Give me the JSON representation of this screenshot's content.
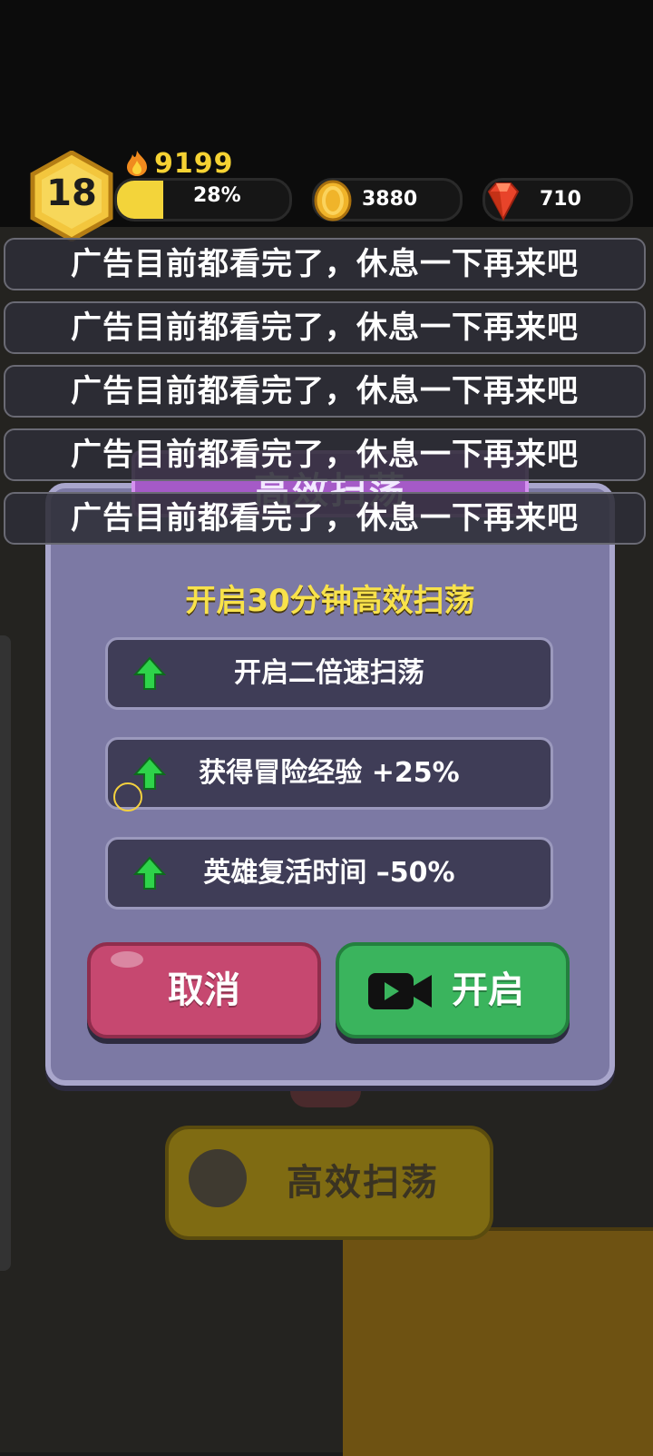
{
  "hud": {
    "level": "18",
    "power": "9199",
    "xp_percent": "28%",
    "xp_fraction": 0.28,
    "gold": "3880",
    "gems": "710",
    "colors": {
      "power": "#f5d233",
      "level_badge": "#f3c63d",
      "gem": "#e8442a",
      "coin": "#f0b42a"
    }
  },
  "notices": [
    "广告目前都看完了，休息一下再来吧",
    "广告目前都看完了，休息一下再来吧",
    "广告目前都看完了，休息一下再来吧",
    "广告目前都看完了，休息一下再来吧",
    "广告目前都看完了，休息一下再来吧"
  ],
  "dialog": {
    "title": "高效扫荡",
    "heading": "开启30分钟高效扫荡",
    "benefits": [
      {
        "text": "开启二倍速扫荡",
        "icon": "green-up-arrow-icon"
      },
      {
        "text": "获得冒险经验  +25%",
        "icon": "green-up-arrow-icon"
      },
      {
        "text": "英雄复活时间  –50%",
        "icon": "green-up-arrow-icon"
      }
    ],
    "cancel_label": "取消",
    "open_label": "开启",
    "open_icon": "video-camera-icon",
    "colors": {
      "panel": "#7c79a4",
      "cancel": "#c64870",
      "open": "#3ab45d",
      "heading": "#f8e24a"
    }
  },
  "background": {
    "button_label": "高效扫荡"
  }
}
